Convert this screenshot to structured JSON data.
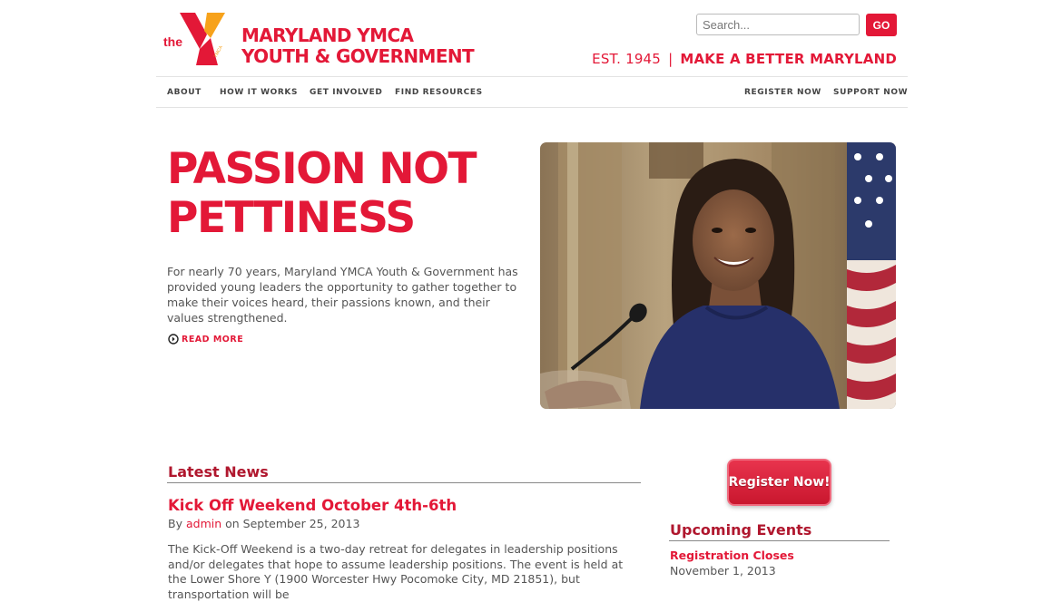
{
  "logo": {
    "the": "the",
    "ymca_small": "YMCA",
    "line1": "MARYLAND YMCA",
    "line2": "YOUTH & GOVERNMENT"
  },
  "search": {
    "placeholder": "Search...",
    "button": "GO"
  },
  "tagline": {
    "est": "EST. 1945",
    "sep": "|",
    "slogan": "MAKE A BETTER MARYLAND"
  },
  "nav": {
    "left": [
      "ABOUT",
      "HOW IT WORKS",
      "GET INVOLVED",
      "FIND RESOURCES"
    ],
    "right": [
      "REGISTER NOW",
      "SUPPORT NOW"
    ]
  },
  "hero": {
    "title_line1": "PASSION NOT",
    "title_line2": "PETTINESS",
    "body": "For nearly 70 years, Maryland YMCA Youth & Government has provided young leaders the opportunity to gather together to make their voices heard, their passions known, and their values strengthened.",
    "read_more": "READ MORE"
  },
  "news": {
    "section_title": "Latest News",
    "post_title": "Kick Off Weekend October 4th-6th",
    "by": "By",
    "author": "admin",
    "on_date": "on September 25, 2013",
    "body": "The Kick-Off Weekend is a two-day retreat for delegates in leadership positions and/or delegates that hope to assume leadership positions. The event is held at the Lower Shore Y (1900 Worcester Hwy Pocomoke City, MD 21851), but transportation will be"
  },
  "sidebar": {
    "register_button": "Register Now!",
    "events_title": "Upcoming Events",
    "event_title": "Registration Closes",
    "event_date": "November 1, 2013"
  },
  "colors": {
    "brand_red": "#e31837",
    "dark_red": "#b0172e",
    "logo_orange": "#f7a21b"
  }
}
